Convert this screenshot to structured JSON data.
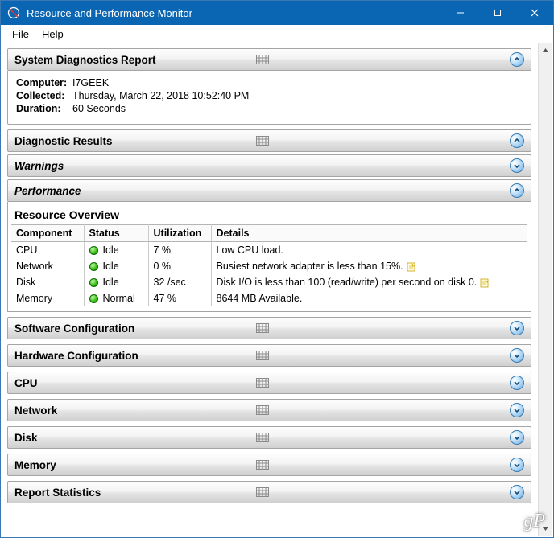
{
  "window": {
    "title": "Resource and Performance Monitor"
  },
  "menu": {
    "file": "File",
    "help": "Help"
  },
  "sections": {
    "system_diag": "System Diagnostics Report",
    "diag_results": "Diagnostic Results",
    "warnings": "Warnings",
    "performance": "Performance",
    "resource_overview": "Resource Overview",
    "software_config": "Software Configuration",
    "hardware_config": "Hardware Configuration",
    "cpu": "CPU",
    "network": "Network",
    "disk": "Disk",
    "memory": "Memory",
    "report_stats": "Report Statistics"
  },
  "diag_meta": {
    "computer_label": "Computer:",
    "computer_value": "I7GEEK",
    "collected_label": "Collected:",
    "collected_value": "Thursday, March 22, 2018 10:52:40 PM",
    "duration_label": "Duration:",
    "duration_value": "60 Seconds"
  },
  "overview": {
    "columns": {
      "component": "Component",
      "status": "Status",
      "utilization": "Utilization",
      "details": "Details"
    },
    "rows": [
      {
        "component": "CPU",
        "status": "Idle",
        "utilization": "7 %",
        "details": "Low CPU load.",
        "note": false
      },
      {
        "component": "Network",
        "status": "Idle",
        "utilization": "0 %",
        "details": "Busiest network adapter is less than 15%.",
        "note": true
      },
      {
        "component": "Disk",
        "status": "Idle",
        "utilization": "32 /sec",
        "details": "Disk I/O is less than 100 (read/write) per second on disk 0.",
        "note": true
      },
      {
        "component": "Memory",
        "status": "Normal",
        "utilization": "47 %",
        "details": "8644 MB Available.",
        "note": false
      }
    ]
  },
  "watermark": "gP"
}
